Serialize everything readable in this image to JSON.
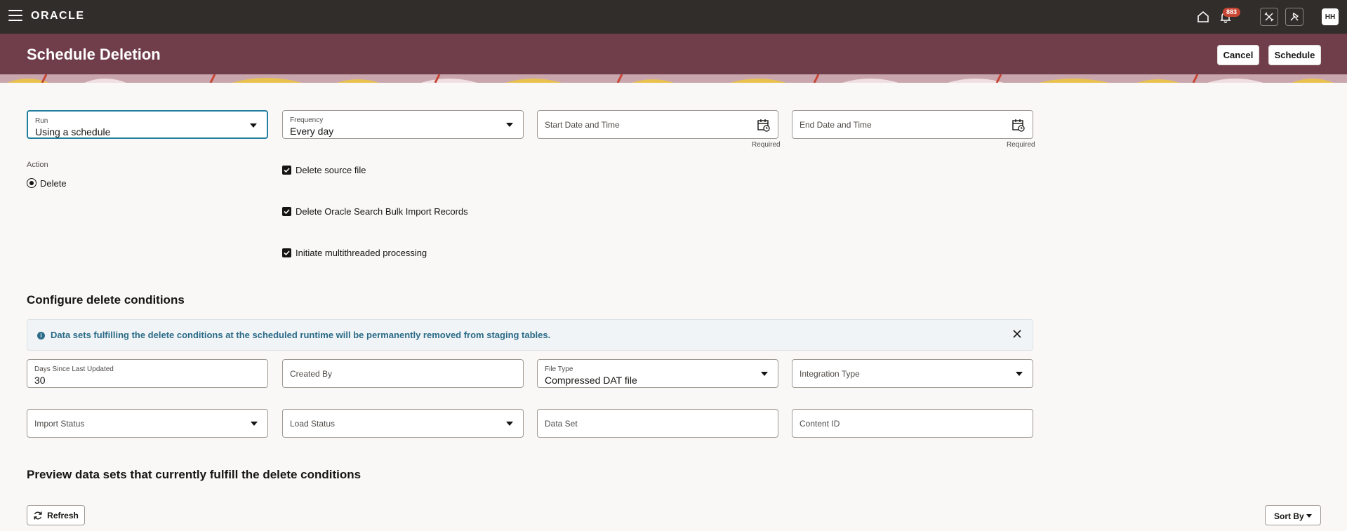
{
  "topbar": {
    "logo": "ORACLE",
    "notification_count": "883",
    "avatar_initials": "HH"
  },
  "header": {
    "title": "Schedule Deletion",
    "cancel_label": "Cancel",
    "schedule_label": "Schedule"
  },
  "schedule": {
    "run": {
      "label": "Run",
      "value": "Using a schedule"
    },
    "frequency": {
      "label": "Frequency",
      "value": "Every day"
    },
    "start": {
      "placeholder": "Start Date and Time",
      "required": "Required"
    },
    "end": {
      "placeholder": "End Date and Time",
      "required": "Required"
    }
  },
  "action": {
    "label": "Action",
    "option": "Delete"
  },
  "checkboxes": [
    {
      "label": "Delete source file",
      "checked": true
    },
    {
      "label": "Delete Oracle Search Bulk Import Records",
      "checked": true
    },
    {
      "label": "Initiate multithreaded processing",
      "checked": true
    }
  ],
  "conditions": {
    "title": "Configure delete conditions",
    "banner": "Data sets fulfilling the delete conditions at the scheduled runtime will be permanently removed from staging tables.",
    "days": {
      "label": "Days Since Last Updated",
      "value": "30"
    },
    "created_by": {
      "placeholder": "Created By"
    },
    "file_type": {
      "label": "File Type",
      "value": "Compressed DAT file"
    },
    "integration_type": {
      "placeholder": "Integration Type"
    },
    "import_status": {
      "placeholder": "Import Status"
    },
    "load_status": {
      "placeholder": "Load Status"
    },
    "data_set": {
      "placeholder": "Data Set"
    },
    "content_id": {
      "placeholder": "Content ID"
    }
  },
  "preview": {
    "title": "Preview data sets that currently fulfill the delete conditions",
    "refresh_label": "Refresh",
    "sort_label": "Sort By"
  },
  "colors": {
    "topbar": "#312d2a",
    "header": "#703e4b",
    "accent": "#227e9e",
    "info": "#2b6b88"
  }
}
